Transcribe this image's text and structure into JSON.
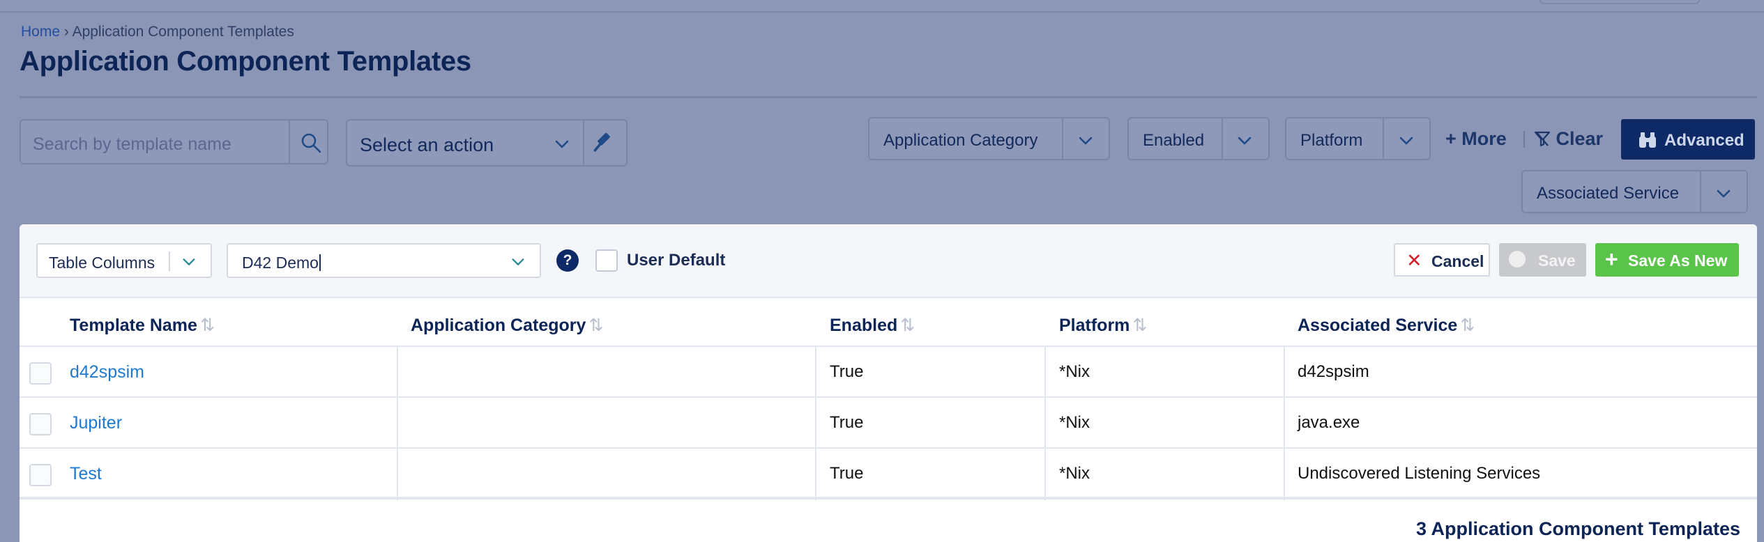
{
  "breadcrumb": {
    "home": "Home",
    "separator": "›",
    "current": "Application Component Templates"
  },
  "page": {
    "title": "Application Component Templates"
  },
  "toolbar": {
    "search_placeholder": "Search by template name",
    "action_label": "Select an action",
    "filters": [
      {
        "label": "Application Category"
      },
      {
        "label": "Enabled"
      },
      {
        "label": "Platform"
      },
      {
        "label": "Associated Service"
      }
    ],
    "more_label": "More",
    "clear_label": "Clear",
    "advanced_label": "Advanced"
  },
  "panel": {
    "table_columns_label": "Table Columns",
    "view_value": "D42 Demo",
    "help_glyph": "?",
    "user_default_label": "User Default",
    "cancel_label": "Cancel",
    "save_label": "Save",
    "save_as_new_label": "Save As New"
  },
  "table": {
    "columns": [
      "Template Name",
      "Application Category",
      "Enabled",
      "Platform",
      "Associated Service"
    ],
    "rows": [
      {
        "name": "d42spsim",
        "category": "",
        "enabled": "True",
        "platform": "*Nix",
        "service": "d42spsim"
      },
      {
        "name": "Jupiter",
        "category": "",
        "enabled": "True",
        "platform": "*Nix",
        "service": "java.exe"
      },
      {
        "name": "Test",
        "category": "",
        "enabled": "True",
        "platform": "*Nix",
        "service": "Undiscovered Listening Services"
      }
    ],
    "count_label": "3 Application Component Templates"
  },
  "colors": {
    "overlay": "#8b96b6",
    "navy": "#0d2a66",
    "link": "#1e79d0",
    "save_as_new": "#5ac44a",
    "cancel_x": "#d4202a"
  }
}
